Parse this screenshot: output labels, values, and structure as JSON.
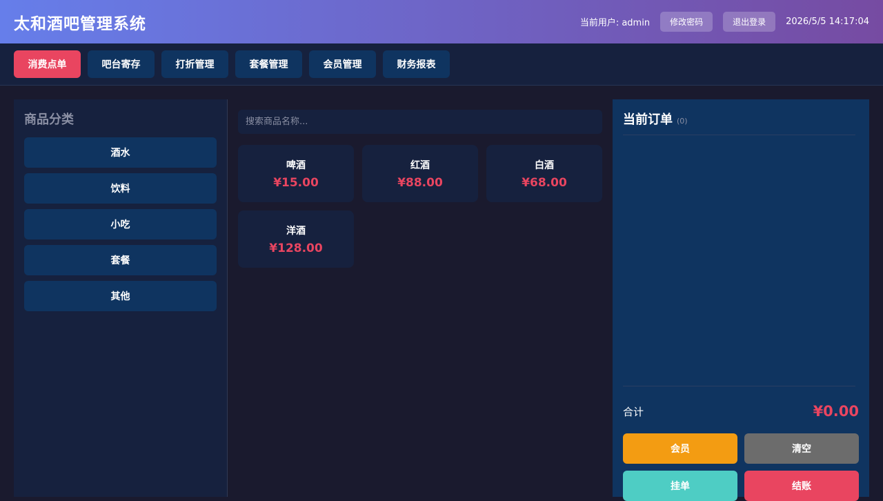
{
  "header": {
    "title": "太和酒吧管理系统",
    "user_label": "当前用户: admin",
    "change_password": "修改密码",
    "logout": "退出登录",
    "datetime": "2026/5/5 14:17:04"
  },
  "nav": {
    "items": [
      {
        "label": "消费点单",
        "active": true
      },
      {
        "label": "吧台寄存",
        "active": false
      },
      {
        "label": "打折管理",
        "active": false
      },
      {
        "label": "套餐管理",
        "active": false
      },
      {
        "label": "会员管理",
        "active": false
      },
      {
        "label": "财务报表",
        "active": false
      }
    ]
  },
  "categories": {
    "title": "商品分类",
    "items": [
      "酒水",
      "饮料",
      "小吃",
      "套餐",
      "其他"
    ]
  },
  "products": {
    "search_placeholder": "搜索商品名称...",
    "items": [
      {
        "name": "啤酒",
        "price": "¥15.00"
      },
      {
        "name": "红酒",
        "price": "¥88.00"
      },
      {
        "name": "白酒",
        "price": "¥68.00"
      },
      {
        "name": "洋酒",
        "price": "¥128.00"
      }
    ]
  },
  "order": {
    "title": "当前订单",
    "count": "(0)",
    "total_label": "合计",
    "total_value": "¥0.00",
    "actions": {
      "member": "会员",
      "clear": "清空",
      "hold": "挂单",
      "checkout": "结账"
    }
  },
  "colors": {
    "accent": "#e94560",
    "member_button": "#f39c12",
    "clear_button": "#6c6c6c",
    "hold_button": "#4ecdc4",
    "checkout_button": "#e94560"
  }
}
